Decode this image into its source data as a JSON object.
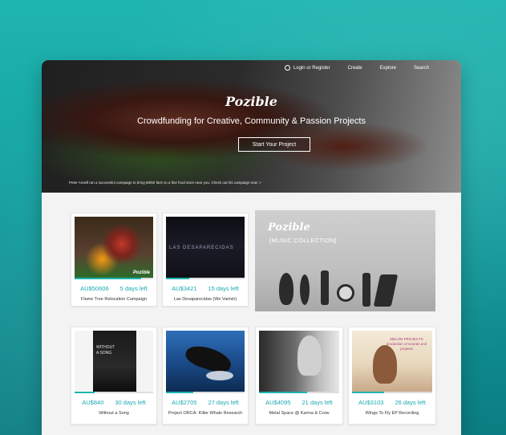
{
  "nav": {
    "login": "Login or Register",
    "create": "Create",
    "explore": "Explore",
    "search": "Search"
  },
  "hero": {
    "logo": "Pozible",
    "tagline": "Crowdfunding for Creative, Community & Passion Projects",
    "cta": "Start Your Project",
    "caption": "Peter Ansell ran a successful campaign to bring 60/60 farm to a fine food store near you. Check out his campaign now. >"
  },
  "promo": {
    "logo": "Pozible",
    "subtitle": "[MUSIC COLLECTION]"
  },
  "cards": [
    {
      "amount": "AU$50606",
      "days": "5 days left",
      "title": "Flame Tree Relocation Campaign",
      "progress": 0.85,
      "badge": "Pozible"
    },
    {
      "amount": "AU$3421",
      "days": "15 days left",
      "title": "Las Desaparecidas (We Vanish)",
      "progress": 0.3,
      "thumb_text": "LAS DESAPARECIDAS"
    },
    {
      "amount": "AU$840",
      "days": "30 days left",
      "title": "Without a Song",
      "progress": 0.25,
      "thumb_text": "WITHOUT A SONG"
    },
    {
      "amount": "AU$2705",
      "days": "27 days left",
      "title": "Project ORCA- Killer Whale Research",
      "progress": 0.35
    },
    {
      "amount": "AU$4095",
      "days": "21 days left",
      "title": "Metal Space @ Karma & Crow",
      "progress": 0.6
    },
    {
      "amount": "AU$3103",
      "days": "26 days left",
      "title": "Wings To Fly EP Recording",
      "progress": 0.4,
      "thumb_text": "MELON PROJECTS production of sounds and projects"
    }
  ],
  "colors": {
    "accent": "#1fb5b0",
    "amount": "#1aa9b3"
  }
}
